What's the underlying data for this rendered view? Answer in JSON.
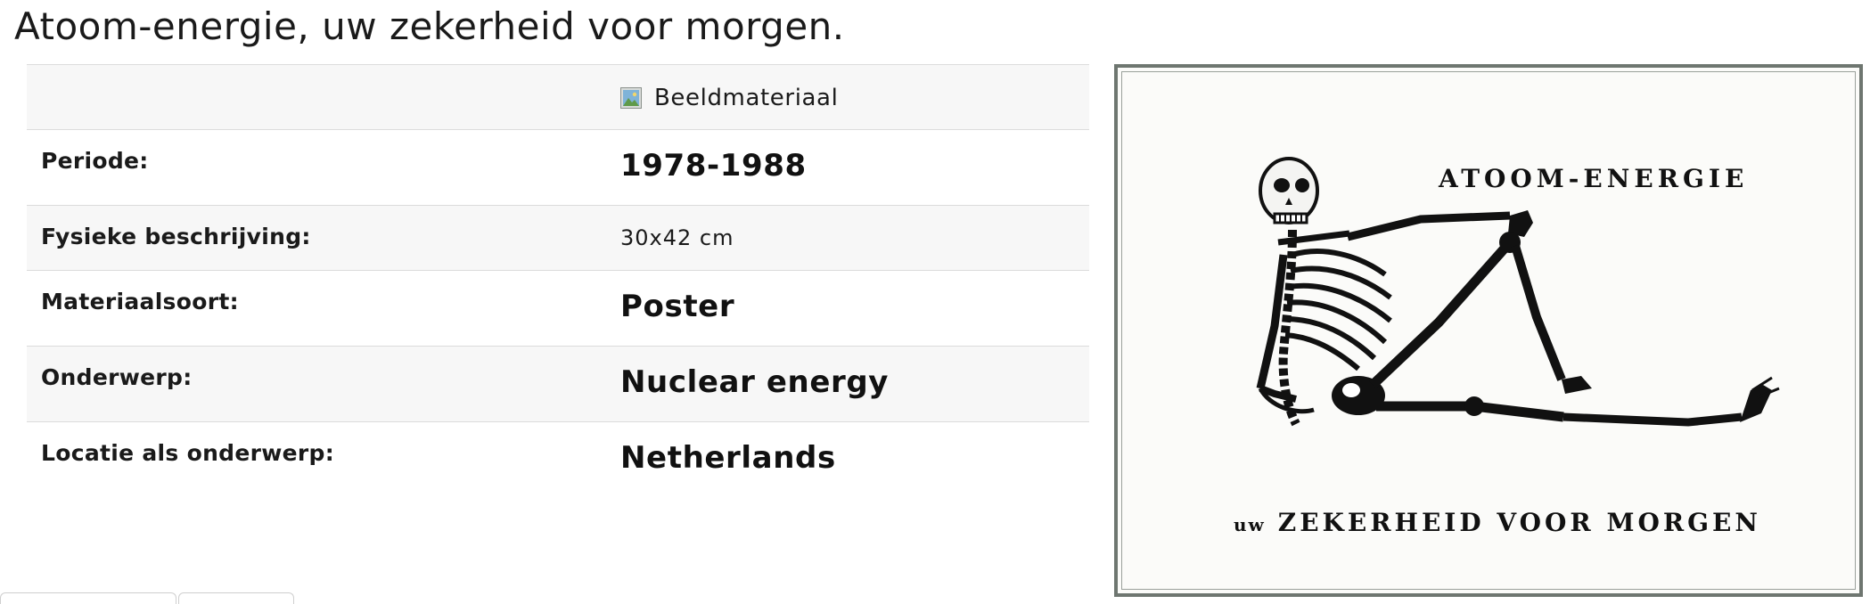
{
  "page": {
    "title": "Atoom-energie, uw zekerheid voor morgen."
  },
  "media": {
    "icon": "image-icon",
    "label": "Beeldmateriaal"
  },
  "metadata": {
    "period_label": "Periode:",
    "period_value": "1978-1988",
    "physical_label": "Fysieke beschrijving:",
    "physical_value": "30x42 cm",
    "material_label": "Materiaalsoort:",
    "material_value": "Poster",
    "subject_label": "Onderwerp:",
    "subject_value": "Nuclear energy",
    "location_label": "Locatie als onderwerp:",
    "location_value": "Netherlands"
  },
  "poster": {
    "text_top": "ATOOM-ENERGIE",
    "text_bottom_prefix": "uw",
    "text_bottom": "ZEKERHEID VOOR MORGEN",
    "frame_color": "#6e7670"
  }
}
